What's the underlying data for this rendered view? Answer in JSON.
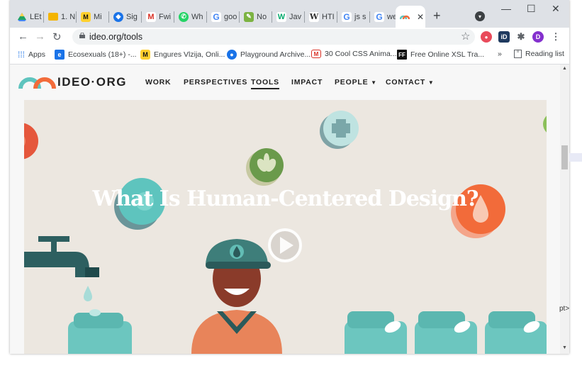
{
  "browser": {
    "tabs": [
      {
        "label": "LEt",
        "icon": "google-drive-icon",
        "color": "#1fa463"
      },
      {
        "label": "1. N",
        "icon": "slides-icon",
        "color": "#f4b400"
      },
      {
        "label": "Mi",
        "icon": "miro-icon",
        "color": "#ffd02f"
      },
      {
        "label": "Sig",
        "icon": "signin-icon",
        "color": "#1a73e8"
      },
      {
        "label": "Fwi",
        "icon": "gmail-icon",
        "color": "#d93025"
      },
      {
        "label": "Wh",
        "icon": "whatsapp-icon",
        "color": "#25d366"
      },
      {
        "label": "goo",
        "icon": "google-icon",
        "color": "#4285f4"
      },
      {
        "label": "No",
        "icon": "notes-icon",
        "color": "#7cb342"
      },
      {
        "label": "Jav",
        "icon": "w3-icon",
        "color": "#04aa6d"
      },
      {
        "label": "HTI",
        "icon": "wikipedia-icon",
        "color": "#333333"
      },
      {
        "label": "js s",
        "icon": "google-icon",
        "color": "#4285f4"
      },
      {
        "label": "we",
        "icon": "google-icon",
        "color": "#4285f4"
      },
      {
        "label": "",
        "icon": "ideo-icon",
        "color": "#f26b3a"
      }
    ],
    "url": "ideo.org/tools",
    "bookmarks": {
      "apps": "Apps",
      "items": [
        {
          "label": "Ecosexuals (18+) -...",
          "icon": "e-icon",
          "color": "#1a73e8"
        },
        {
          "label": "Engures Vlzija, Onli...",
          "icon": "miro-icon",
          "color": "#ffd02f"
        },
        {
          "label": "Playground Archive...",
          "icon": "drop-icon",
          "color": "#1a73e8"
        },
        {
          "label": "30 Cool CSS Anima...",
          "icon": "mail-icon",
          "color": "#d93025"
        },
        {
          "label": "Free Online XSL Tra...",
          "icon": "ff-icon",
          "color": "#111111"
        }
      ],
      "more": "»",
      "reading_list": "Reading list"
    },
    "profile_initial": "D"
  },
  "site": {
    "logo": "IDEO·ORG",
    "nav": [
      {
        "label": "WORK"
      },
      {
        "label": "PERSPECTIVES"
      },
      {
        "label": "TOOLS"
      },
      {
        "label": "IMPACT"
      },
      {
        "label": "PEOPLE"
      },
      {
        "label": "CONTACT"
      }
    ],
    "hero_title": "What Is Human-Centered Design?"
  },
  "behind_window_text": "pt>",
  "colors": {
    "teal": "#5ec4be",
    "orange": "#f26b3a",
    "green": "#6a9a4b"
  }
}
